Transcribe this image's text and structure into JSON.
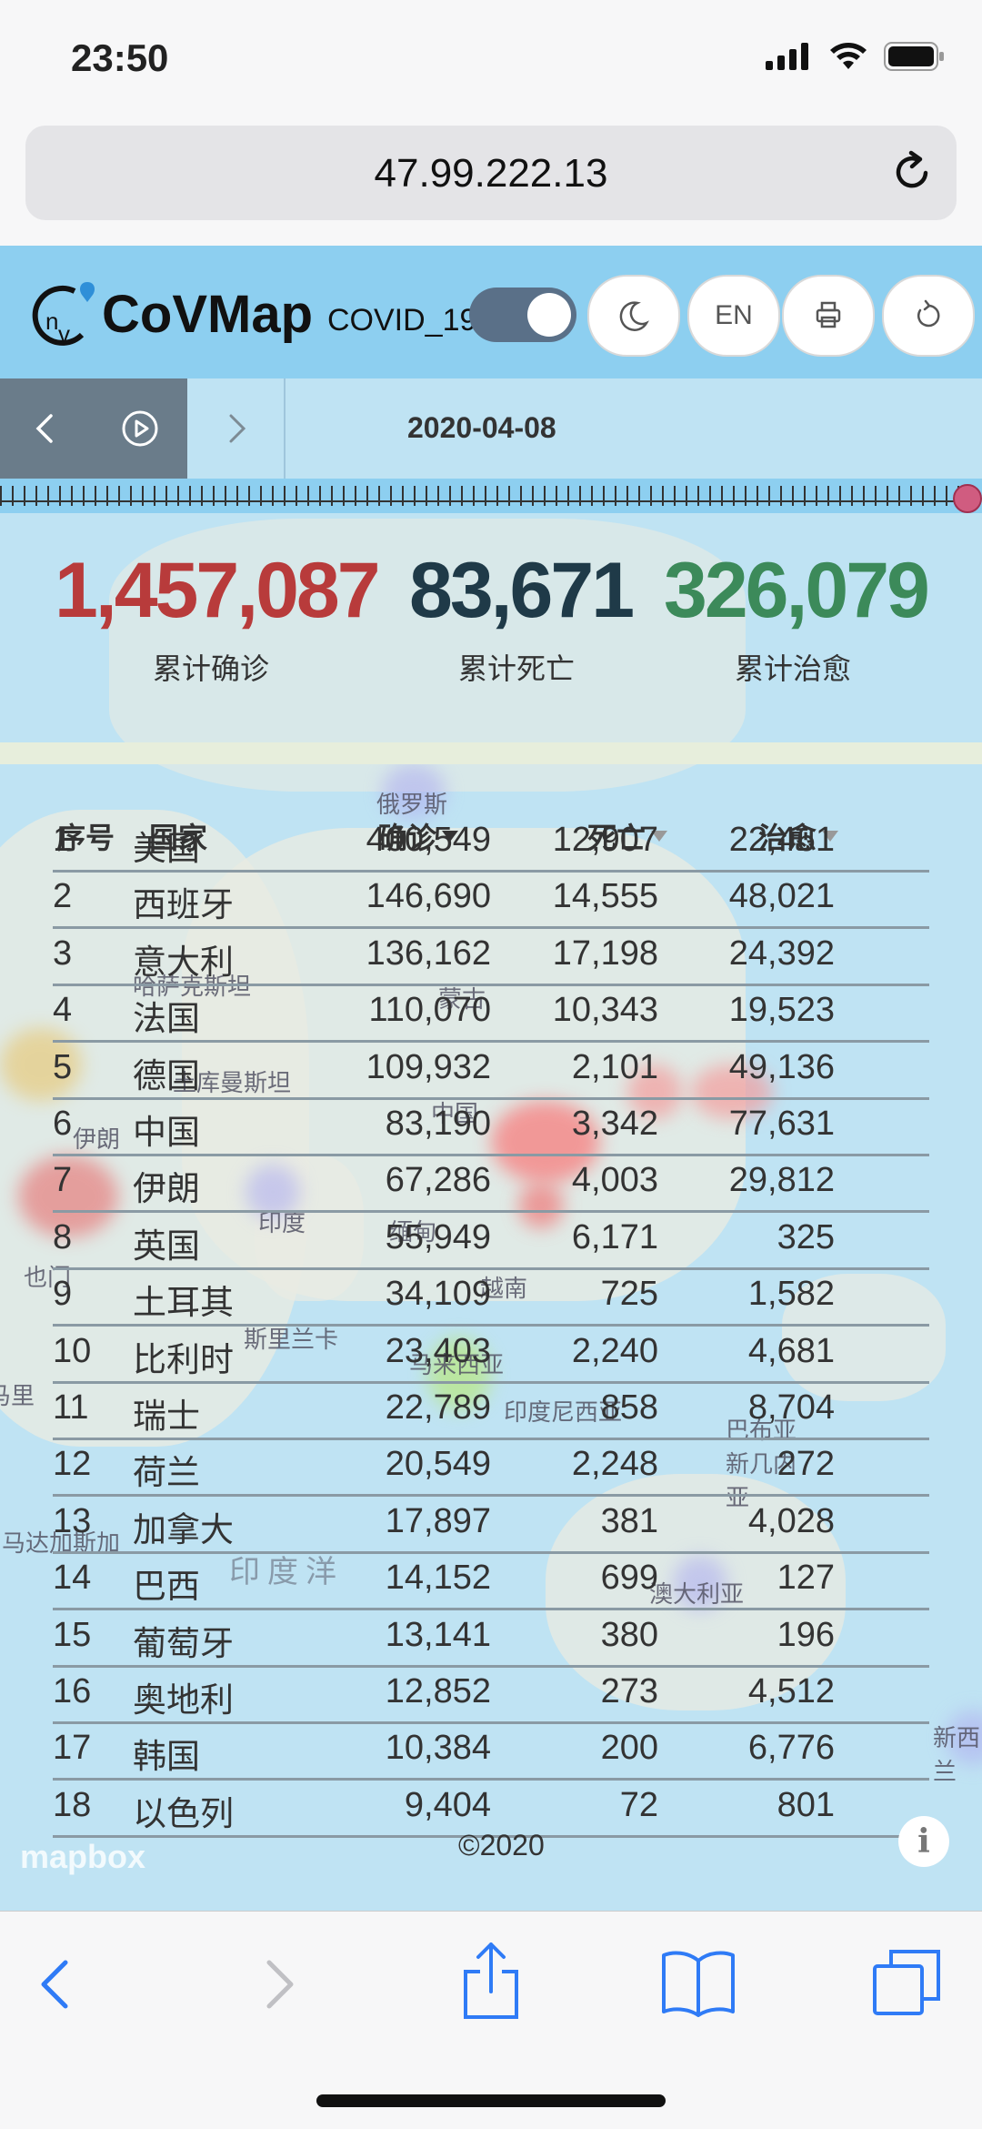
{
  "status_bar": {
    "time": "23:50"
  },
  "browser": {
    "url": "47.99.222.13"
  },
  "app": {
    "brand": "CoVMap",
    "subtitle": "COVID_19",
    "lang_button": "EN",
    "date": "2020-04-08"
  },
  "stats": {
    "confirmed": "1,457,087",
    "deaths": "83,671",
    "recovered": "326,079",
    "confirmed_label": "累计确诊",
    "deaths_label": "累计死亡",
    "recovered_label": "累计治愈",
    "colors": {
      "confirmed": "#b83b3b",
      "deaths": "#1f3a48",
      "recovered": "#3c8a5a"
    }
  },
  "table": {
    "headers": {
      "rank": "序号",
      "country": "国家",
      "confirmed": "确诊",
      "deaths": "死亡",
      "recovered": "治愈"
    },
    "rows": [
      {
        "rank": "1",
        "country": "美国",
        "confirmed": "400,549",
        "deaths": "12,907",
        "recovered": "22,461"
      },
      {
        "rank": "2",
        "country": "西班牙",
        "confirmed": "146,690",
        "deaths": "14,555",
        "recovered": "48,021"
      },
      {
        "rank": "3",
        "country": "意大利",
        "confirmed": "136,162",
        "deaths": "17,198",
        "recovered": "24,392"
      },
      {
        "rank": "4",
        "country": "法国",
        "confirmed": "110,070",
        "deaths": "10,343",
        "recovered": "19,523"
      },
      {
        "rank": "5",
        "country": "德国",
        "confirmed": "109,932",
        "deaths": "2,101",
        "recovered": "49,136"
      },
      {
        "rank": "6",
        "country": "中国",
        "confirmed": "83,190",
        "deaths": "3,342",
        "recovered": "77,631"
      },
      {
        "rank": "7",
        "country": "伊朗",
        "confirmed": "67,286",
        "deaths": "4,003",
        "recovered": "29,812"
      },
      {
        "rank": "8",
        "country": "英国",
        "confirmed": "55,949",
        "deaths": "6,171",
        "recovered": "325"
      },
      {
        "rank": "9",
        "country": "土耳其",
        "confirmed": "34,109",
        "deaths": "725",
        "recovered": "1,582"
      },
      {
        "rank": "10",
        "country": "比利时",
        "confirmed": "23,403",
        "deaths": "2,240",
        "recovered": "4,681"
      },
      {
        "rank": "11",
        "country": "瑞士",
        "confirmed": "22,789",
        "deaths": "858",
        "recovered": "8,704"
      },
      {
        "rank": "12",
        "country": "荷兰",
        "confirmed": "20,549",
        "deaths": "2,248",
        "recovered": "272"
      },
      {
        "rank": "13",
        "country": "加拿大",
        "confirmed": "17,897",
        "deaths": "381",
        "recovered": "4,028"
      },
      {
        "rank": "14",
        "country": "巴西",
        "confirmed": "14,152",
        "deaths": "699",
        "recovered": "127"
      },
      {
        "rank": "15",
        "country": "葡萄牙",
        "confirmed": "13,141",
        "deaths": "380",
        "recovered": "196"
      },
      {
        "rank": "16",
        "country": "奥地利",
        "confirmed": "12,852",
        "deaths": "273",
        "recovered": "4,512"
      },
      {
        "rank": "17",
        "country": "韩国",
        "confirmed": "10,384",
        "deaths": "200",
        "recovered": "6,776"
      },
      {
        "rank": "18",
        "country": "以色列",
        "confirmed": "9,404",
        "deaths": "72",
        "recovered": "801"
      }
    ]
  },
  "map_labels": [
    "俄罗斯",
    "蒙古",
    "中国",
    "哈萨克斯坦",
    "土库曼斯坦",
    "伊朗",
    "印度",
    "缅甸",
    "越南",
    "斯里兰卡",
    "马来西亚",
    "印度尼西亚",
    "巴布亚新几内亚",
    "澳大利亚",
    "印度洋",
    "也门",
    "索马里",
    "马达加斯加",
    "新西兰"
  ],
  "map_attribution": {
    "logo": "mapbox",
    "copyright": "©2020"
  },
  "info_button": "i"
}
